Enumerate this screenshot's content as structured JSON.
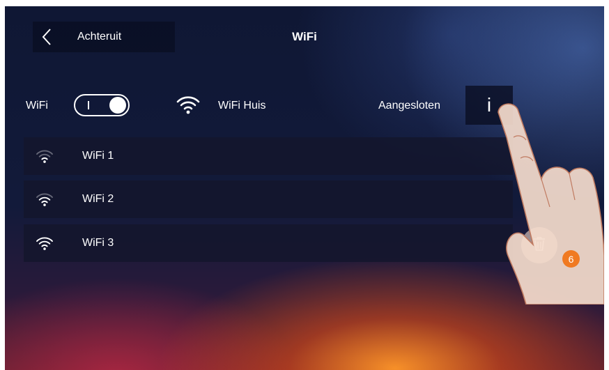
{
  "header": {
    "back_label": "Achteruit",
    "title": "WiFi"
  },
  "wifi_toggle": {
    "label": "WiFi",
    "state": "on"
  },
  "current_network": {
    "name": "WiFi Huis",
    "status": "Aangesloten",
    "info_label": "i"
  },
  "networks": [
    {
      "name": "WiFi 1",
      "icon": "wifi-icon"
    },
    {
      "name": "WiFi 2",
      "icon": "wifi-icon"
    },
    {
      "name": "WiFi 3",
      "icon": "wifi-icon"
    }
  ],
  "callout": {
    "number": "6"
  },
  "colors": {
    "accent": "#f07a22"
  }
}
